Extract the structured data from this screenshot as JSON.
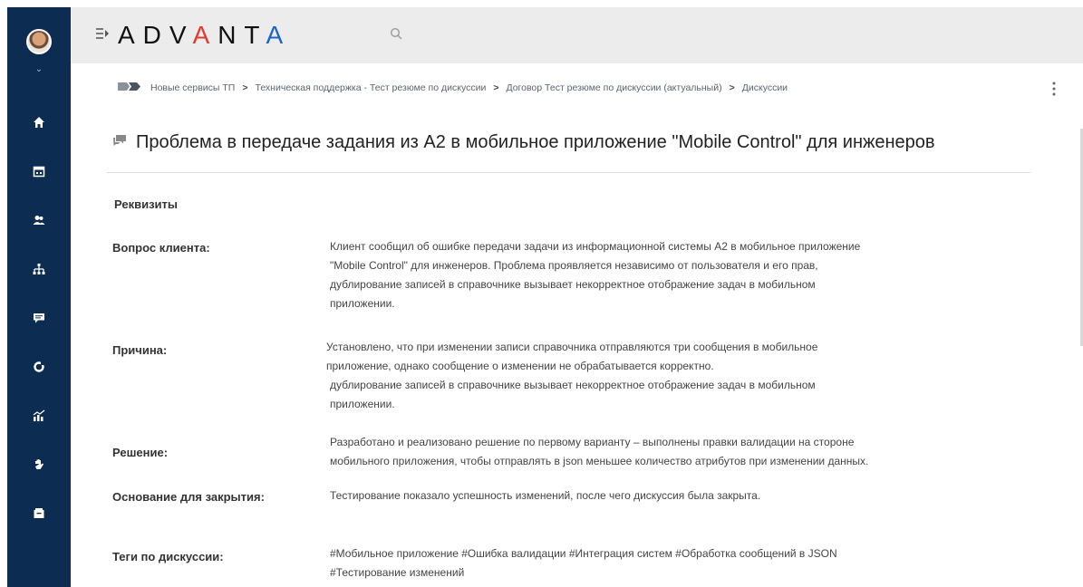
{
  "brand": {
    "logo_parts": [
      "ADV",
      "A",
      "NT",
      "A"
    ],
    "accent": "#e23a2f",
    "brand_blue": "#1c64c8",
    "sidebar_bg": "#0d2c52"
  },
  "sidebar": {
    "icons": [
      "home-icon",
      "calendar-icon",
      "users-icon",
      "org-chart-icon",
      "chat-icon",
      "refresh-icon",
      "analytics-icon",
      "hand-icon",
      "inbox-icon"
    ]
  },
  "breadcrumb": {
    "items": [
      "Новые сервисы ТП",
      "Техническая поддержка - Тест резюме по дискуссии",
      "Договор Тест резюме по дискуссии (актуальный)",
      "Дискуссии"
    ],
    "separator": ">"
  },
  "page": {
    "title": "Проблема в передаче задания из А2 в мобильное приложение \"Mobile Control\" для инженеров"
  },
  "requisites": {
    "section_title": "Реквизиты",
    "fields": [
      {
        "label": "Вопрос клиента:",
        "lines": [
          "Клиент сообщил об ошибке передачи задачи из информационной системы А2 в мобильное приложение",
          "\"Mobile Control\" для инженеров. Проблема проявляется независимо от пользователя и его прав,",
          "дублирование записей в справочнике вызывает некорректное отображение задач в мобильном",
          "приложении."
        ]
      },
      {
        "label": "Причина:",
        "lines": [
          "Установлено, что при изменении записи справочника отправляются три сообщения в мобильное",
          "приложение, однако сообщение о изменении не обрабатывается корректно.",
          "дублирование записей в справочнике вызывает некорректное отображение задач в мобильном",
          "приложении."
        ]
      },
      {
        "label": "Решение:",
        "lines": [
          "Разработано и реализовано решение по первому варианту – выполнены правки валидации на стороне",
          "мобильного приложения, чтобы отправлять в json меньшее количество атрибутов при изменении данных."
        ]
      },
      {
        "label": "Основание для закрытия:",
        "lines": [
          "Тестирование показало успешность изменений, после чего дискуссия была закрыта."
        ]
      },
      {
        "label": "Теги по дискуссии:",
        "lines": [
          "#Мобильное приложение #Ошибка валидации #Интеграция систем #Обработка сообщений в JSON",
          "#Тестирование изменений"
        ]
      }
    ]
  }
}
